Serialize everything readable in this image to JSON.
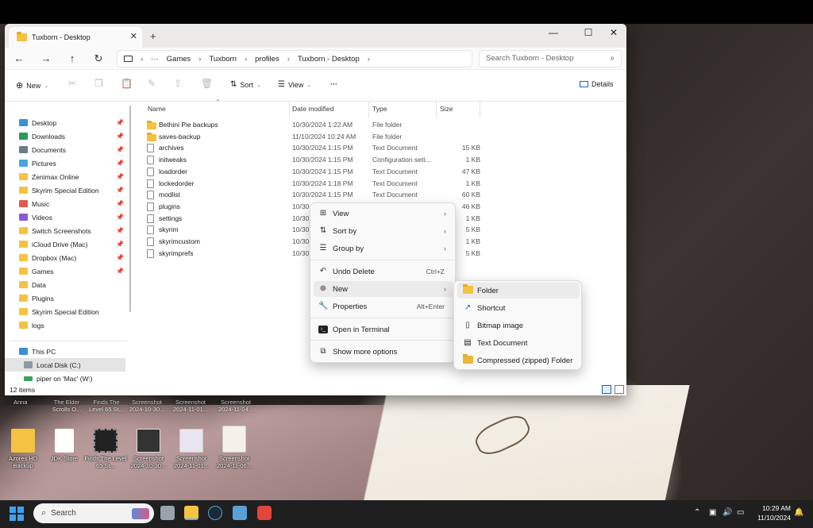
{
  "window": {
    "tab_title": "Tuxborn - Desktop",
    "tab_close": "✕",
    "new_tab": "+",
    "minimize": "—",
    "maximize": "☐",
    "close": "✕"
  },
  "address": {
    "back": "←",
    "forward": "→",
    "up": "↑",
    "refresh": "↻",
    "more": "···",
    "crumbs": [
      "Games",
      "Tuxborn",
      "profiles",
      "Tuxborn - Desktop"
    ],
    "search_placeholder": "Search Tuxborn - Desktop"
  },
  "toolbar": {
    "new": "New",
    "sort": "Sort",
    "view": "View",
    "more": "···",
    "details": "Details"
  },
  "sidebar": {
    "quick_access": [
      "Desktop",
      "Downloads",
      "Documents",
      "Pictures",
      "Zenimax Online",
      "Skyrim Special Edition",
      "Music",
      "Videos",
      "Switch Screenshots",
      "iCloud Drive (Mac)",
      "Dropbox (Mac)",
      "Games"
    ],
    "folders": [
      "Data",
      "Plugins",
      "Skyrim Special Edition",
      "logs"
    ],
    "this_pc": "This PC",
    "local_disk": "Local Disk (C:)",
    "network_drive": "piper on 'Mac' (W:)"
  },
  "columns": {
    "name": "Name",
    "date": "Date modified",
    "type": "Type",
    "size": "Size"
  },
  "files": [
    {
      "name": "Bethini Pie backups",
      "date": "10/30/2024 1:22 AM",
      "type": "File folder",
      "size": "",
      "folder": true
    },
    {
      "name": "saves-backup",
      "date": "11/10/2024 10:24 AM",
      "type": "File folder",
      "size": "",
      "folder": true
    },
    {
      "name": "archives",
      "date": "10/30/2024 1:15 PM",
      "type": "Text Document",
      "size": "15 KB"
    },
    {
      "name": "initweaks",
      "date": "10/30/2024 1:15 PM",
      "type": "Configuration sett...",
      "size": "1 KB"
    },
    {
      "name": "loadorder",
      "date": "10/30/2024 1:15 PM",
      "type": "Text Document",
      "size": "47 KB"
    },
    {
      "name": "lockedorder",
      "date": "10/30/2024 1:18 PM",
      "type": "Text Document",
      "size": "1 KB"
    },
    {
      "name": "modlist",
      "date": "10/30/2024 1:15 PM",
      "type": "Text Document",
      "size": "60 KB"
    },
    {
      "name": "plugins",
      "date": "10/30",
      "type": "",
      "size": "46 KB"
    },
    {
      "name": "settings",
      "date": "10/30",
      "type": "",
      "size": "1 KB"
    },
    {
      "name": "skyrim",
      "date": "10/30",
      "type": "",
      "size": "5 KB"
    },
    {
      "name": "skyrimcustom",
      "date": "10/30",
      "type": "",
      "size": "1 KB"
    },
    {
      "name": "skyrimprefs",
      "date": "10/30",
      "type": "",
      "size": "5 KB"
    }
  ],
  "status": {
    "count": "12 items"
  },
  "context_menu": {
    "view": "View",
    "sort_by": "Sort by",
    "group_by": "Group by",
    "undo_delete": "Undo Delete",
    "undo_shortcut": "Ctrl+Z",
    "new": "New",
    "properties": "Properties",
    "properties_shortcut": "Alt+Enter",
    "open_terminal": "Open in Terminal",
    "show_more": "Show more options"
  },
  "submenu": {
    "folder": "Folder",
    "shortcut": "Shortcut",
    "bitmap": "Bitmap image",
    "text_document": "Text Document",
    "compressed": "Compressed (zipped) Folder"
  },
  "desktop": {
    "row1_labels": [
      "Anna",
      "The Elder Scrolls O...",
      "Finds The Level 65 St...",
      "Screenshot 2024-10-30...",
      "Screenshot 2024-11-01...",
      "Screenshot 2024-11-04..."
    ],
    "row2_labels": [
      "Azores HD Backup",
      "JDK Store",
      "Finds The Level 65 St...",
      "Screenshot 2024-10-30...",
      "Screenshot 2024-11-01...",
      "Screenshot 2024-11-06..."
    ]
  },
  "taskbar": {
    "search": "Search",
    "time": "10:29 AM",
    "date": "11/10/2024"
  },
  "colors": {
    "folder": "#f5c242",
    "accent": "#0067c0",
    "taskbar": "#1f1f1f"
  }
}
